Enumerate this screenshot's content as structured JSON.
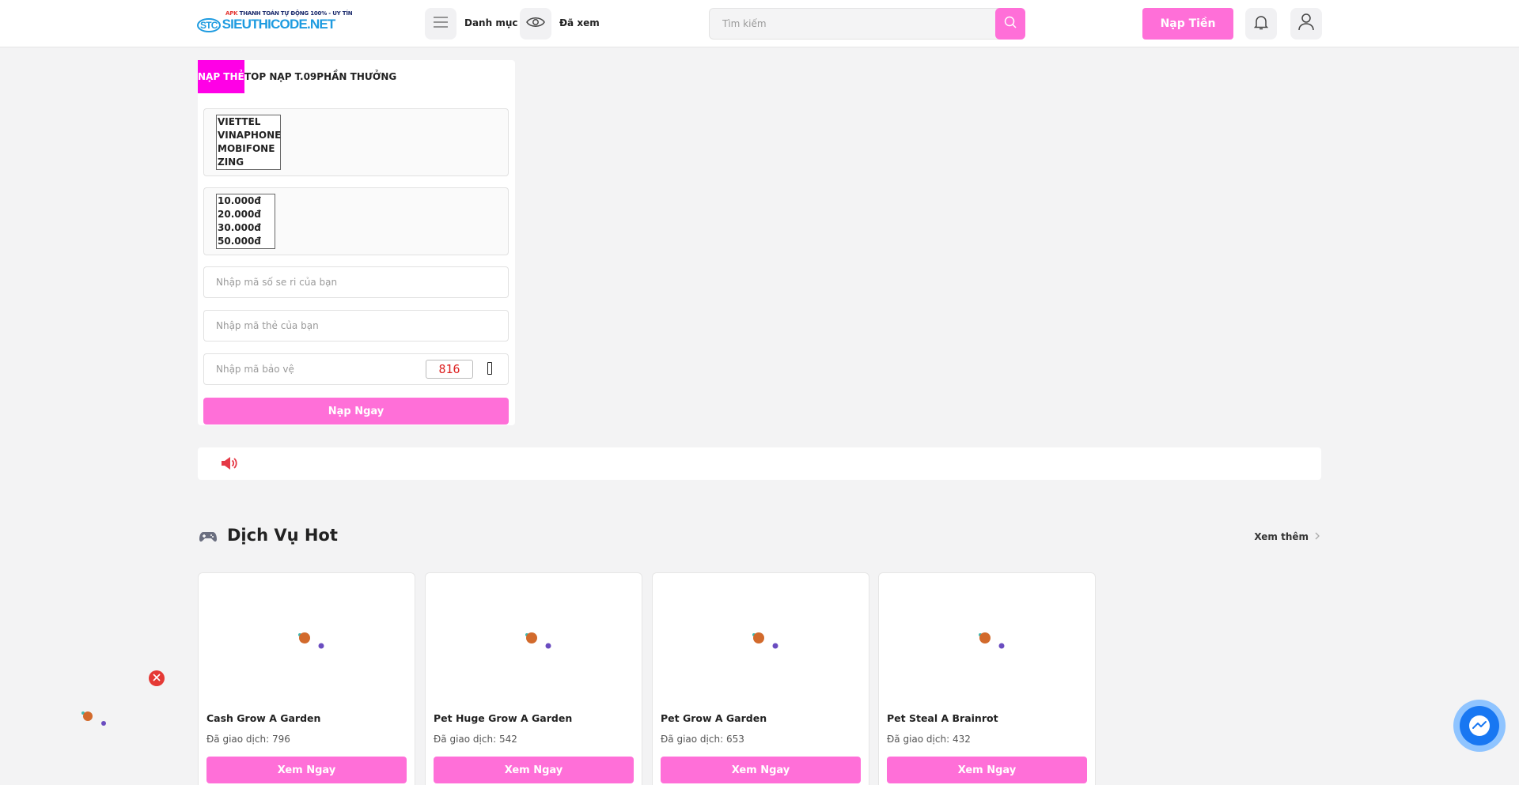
{
  "header": {
    "logo_tagline_prefix": "APK",
    "logo_tagline": "THANH TOÁN TỰ ĐỘNG 100% - UY TÍN",
    "logo_brand": "SIEUTHICODE.NET",
    "logo_mark": "STC",
    "menu_label": "Danh mục",
    "viewed_label": "Đã xem",
    "search_placeholder": "Tìm kiếm",
    "topup_label": "Nạp Tiền"
  },
  "recharge": {
    "tabs": [
      {
        "label": "NẠP THẺ",
        "active": true
      },
      {
        "label": "TOP NẠP T.09",
        "active": false
      },
      {
        "label": "PHẦN THƯỞNG",
        "active": false
      }
    ],
    "carriers": [
      "VIETTEL",
      "VINAPHONE",
      "MOBIFONE",
      "ZING"
    ],
    "amounts": [
      "10.000đ",
      "20.000đ",
      "30.000đ",
      "50.000đ"
    ],
    "serial_placeholder": "Nhập mã số se ri của bạn",
    "code_placeholder": "Nhập mã thẻ của bạn",
    "captcha_placeholder": "Nhập mã bảo vệ",
    "captcha_value": "816",
    "submit_label": "Nạp Ngay"
  },
  "hot_services": {
    "title": "Dịch Vụ Hot",
    "more_label": "Xem thêm",
    "items": [
      {
        "name": "Cash Grow A Garden",
        "sold": "Đã giao dịch: 796",
        "button": "Xem Ngay"
      },
      {
        "name": "Pet Huge Grow A Garden",
        "sold": "Đã giao dịch: 542",
        "button": "Xem Ngay"
      },
      {
        "name": "Pet Grow A Garden",
        "sold": "Đã giao dịch: 653",
        "button": "Xem Ngay"
      },
      {
        "name": "Pet Steal A Brainrot",
        "sold": "Đã giao dịch: 432",
        "button": "Xem Ngay"
      }
    ]
  },
  "colors": {
    "accent": "#ff6fd8",
    "active_tab": "#ff00e6",
    "logo_blue": "#1e9be0",
    "close_red": "#e53935",
    "messenger_blue": "#1877f2"
  },
  "icons": [
    "hamburger-icon",
    "eye-icon",
    "search-icon",
    "bell-icon",
    "user-icon",
    "speaker-icon",
    "gamepad-icon",
    "chevron-right-icon",
    "close-icon",
    "messenger-icon"
  ]
}
